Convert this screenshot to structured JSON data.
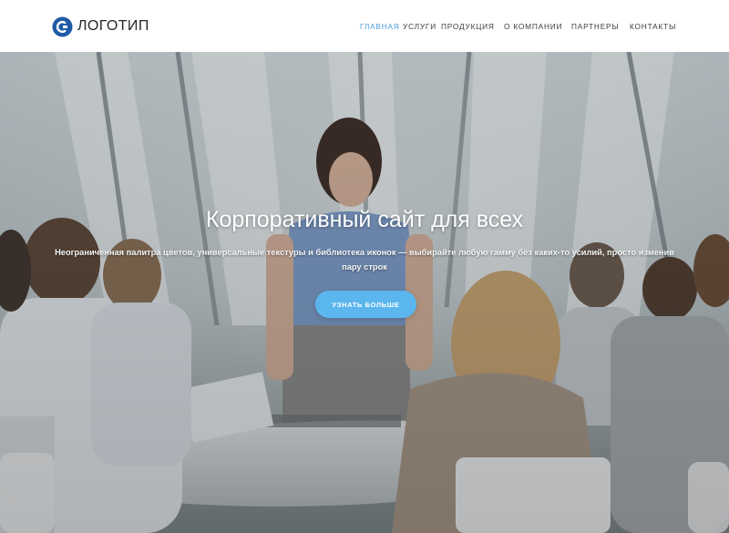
{
  "header": {
    "logo_text": "ЛОГОТИП",
    "logo_icon": "logo-icon",
    "nav": [
      {
        "label": "ГЛАВНАЯ",
        "active": true
      },
      {
        "label": "УСЛУГИ",
        "active": false
      },
      {
        "label": "ПРОДУКЦИЯ",
        "active": false
      },
      {
        "label": "О КОМПАНИИ",
        "active": false
      },
      {
        "label": "ПАРТНЕРЫ",
        "active": false
      },
      {
        "label": "КОНТАКТЫ",
        "active": false
      }
    ]
  },
  "hero": {
    "title": "Корпоративный сайт для всех",
    "subtitle": "Неограниченная палитра цветов, универсальные текстуры и библиотека иконок — выбирайте любую гамму без каких-то усилий, просто изменив пару строк",
    "button_label": "УЗНАТЬ БОЛЬШЕ"
  },
  "colors": {
    "accent": "#4a9fd8",
    "button": "#5bb6ee",
    "logo": "#1f5aa6",
    "header_bg": "#ffffff"
  }
}
